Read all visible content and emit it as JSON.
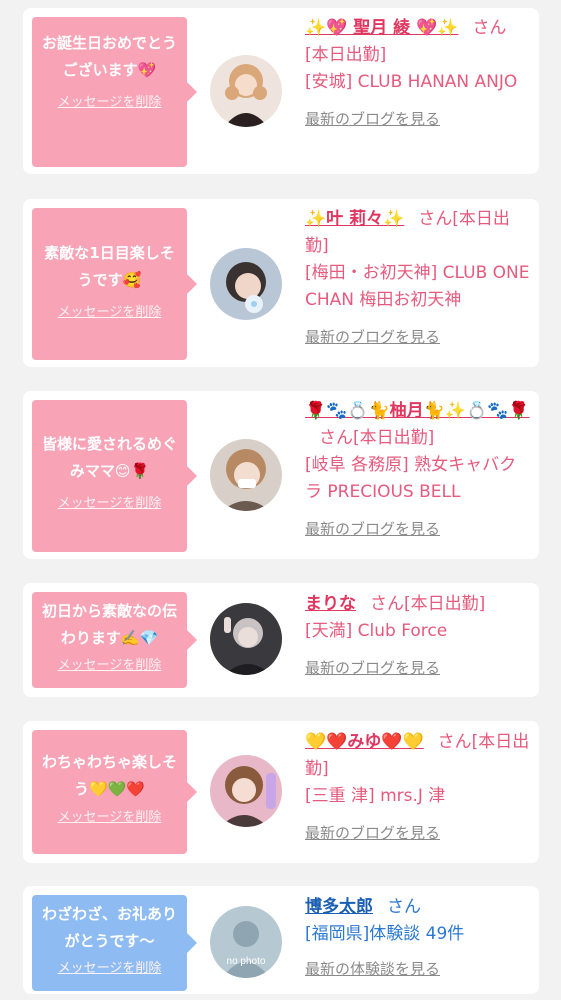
{
  "entries": [
    {
      "message": "お誕生日おめでとうございます💖",
      "delete_label": "メッセージを削除",
      "name": "✨💖 聖月 綾 💖✨",
      "honorific": "さん",
      "status": "[本日出勤]",
      "location": "[安城] CLUB HANAN ANJO",
      "link": "最新のブログを見る",
      "theme": "pink",
      "avatar_icon": "profile-photo"
    },
    {
      "message": "素敵な1日目楽しそうです🥰",
      "delete_label": "メッセージを削除",
      "name": "✨叶 莉々✨",
      "honorific": "さん",
      "status": "[本日出勤]",
      "location": "[梅田・お初天神] CLUB ONE CHAN 梅田お初天神",
      "link": "最新のブログを見る",
      "theme": "pink",
      "avatar_icon": "profile-photo"
    },
    {
      "message": "皆様に愛されるめぐみママ😊🌹",
      "delete_label": "メッセージを削除",
      "name": "🌹🐾💍🐈柚月🐈✨💍🐾🌹",
      "honorific": "さん",
      "status": "[本日出勤]",
      "location": "[岐阜 各務原] 熟女キャバクラ PRECIOUS BELL",
      "link": "最新のブログを見る",
      "theme": "pink",
      "avatar_icon": "profile-photo"
    },
    {
      "message": "初日から素敵なの伝わります✍️💎",
      "delete_label": "メッセージを削除",
      "name": "まりな",
      "honorific": "さん",
      "status": "[本日出勤]",
      "location": "[天満] Club Force",
      "link": "最新のブログを見る",
      "theme": "pink",
      "avatar_icon": "profile-photo"
    },
    {
      "message": "わちゃわちゃ楽しそう💛💚❤️",
      "delete_label": "メッセージを削除",
      "name": "💛❤️みゆ❤️💛",
      "honorific": "さん",
      "status": "[本日出勤]",
      "location": "[三重 津] mrs.J 津",
      "link": "最新のブログを見る",
      "theme": "pink",
      "avatar_icon": "profile-photo"
    },
    {
      "message": "わざわざ、お礼ありがとうです〜",
      "delete_label": "メッセージを削除",
      "name": "博多太郎",
      "honorific": "さん",
      "status": "",
      "location": "[福岡県]体験談 49件",
      "link": "最新の体験談を見る",
      "theme": "blue",
      "avatar_icon": "no-photo",
      "avatar_text": "no photo"
    }
  ],
  "colors": {
    "bubble_pink": "#f8a3b6",
    "bubble_blue": "#8ebcf2",
    "text_pink": "#e55a7d",
    "text_blue": "#2b78d2",
    "link_gray": "#8a8a8a",
    "background": "#f2f2f2"
  }
}
